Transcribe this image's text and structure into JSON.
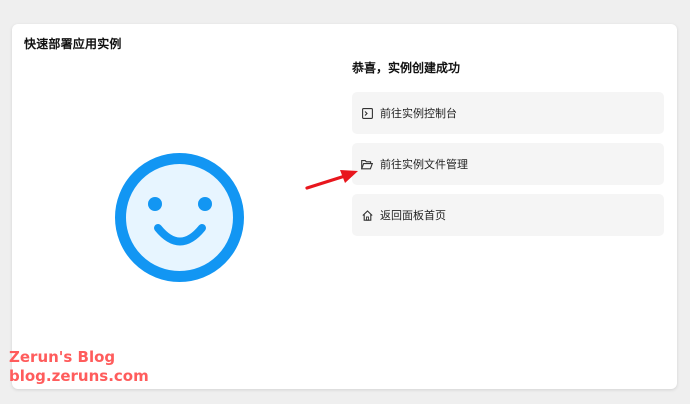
{
  "card": {
    "title": "快速部署应用实例"
  },
  "result": {
    "title": "恭喜，实例创建成功",
    "actions": [
      {
        "label": "前往实例控制台",
        "icon": "terminal-icon"
      },
      {
        "label": "前往实例文件管理",
        "icon": "folder-open-icon"
      },
      {
        "label": "返回面板首页",
        "icon": "home-icon"
      }
    ]
  },
  "smiley": {
    "icon": "smiley-face-icon",
    "stroke_color": "#1296f3",
    "fill_color": "#e7f5ff"
  },
  "annotation": {
    "arrow_color": "#e8161d"
  },
  "watermark": {
    "line1": "Zerun's Blog",
    "line2": "blog.zeruns.com",
    "color": "#ff5c5c"
  }
}
